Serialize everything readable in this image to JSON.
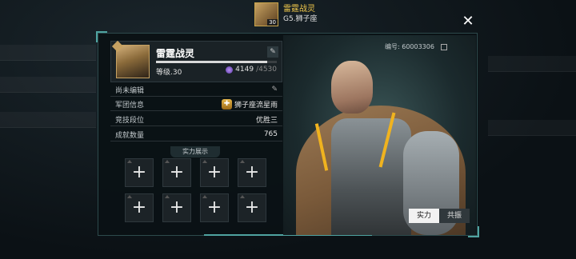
{
  "header": {
    "player_name": "雷霆战灵",
    "subtitle": "G5.狮子座",
    "avatar_level": "30",
    "close_icon": "close-icon"
  },
  "profile": {
    "name": "雷霆战灵",
    "level_label": "等级.30",
    "xp_fraction": 0.92,
    "currency_value": "4149",
    "currency_max": "/4530",
    "edit_icon": "pencil-icon",
    "id_label": "编号: 60003306"
  },
  "info_rows": [
    {
      "label": "尚未编辑",
      "value": ""
    },
    {
      "label": "军团信息",
      "value": "狮子座流星雨"
    },
    {
      "label": "竞技段位",
      "value": "优胜三"
    },
    {
      "label": "成就数量",
      "value": "765"
    }
  ],
  "showcase": {
    "title": "实力展示",
    "slot_icon": "plus-icon",
    "slots": [
      "+",
      "+",
      "+",
      "+",
      "+",
      "+",
      "+",
      "+"
    ]
  },
  "tabs": [
    {
      "label": "实力",
      "active": true
    },
    {
      "label": "共振",
      "active": false
    }
  ],
  "colors": {
    "accent": "#4fa3a0",
    "gold": "#f2c94c",
    "panel_bg": "#0a1215"
  }
}
